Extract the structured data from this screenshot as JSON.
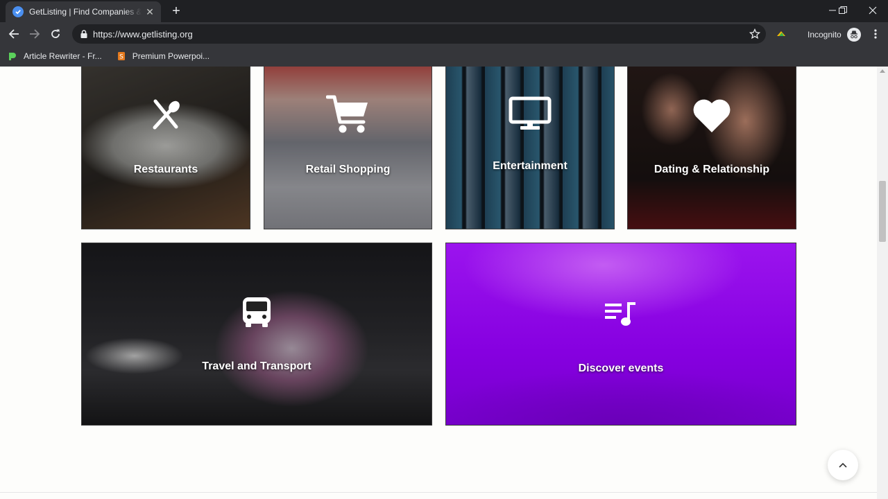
{
  "browser": {
    "tab_title": "GetListing | Find Companies & Tr",
    "url": "https://www.getlisting.org",
    "profile_label": "Incognito",
    "bookmarks": [
      {
        "label": "Article Rewriter - Fr...",
        "icon": "rewriter-favicon"
      },
      {
        "label": "Premium Powerpoi...",
        "icon": "slides-favicon"
      }
    ]
  },
  "categories": [
    {
      "label": "Restaurants",
      "icon": "fork-spoon-icon"
    },
    {
      "label": "Retail Shopping",
      "icon": "shopping-cart-icon"
    },
    {
      "label": "Entertainment",
      "icon": "monitor-icon"
    },
    {
      "label": "Dating & Relationship",
      "icon": "heart-icon"
    },
    {
      "label": "Travel and Transport",
      "icon": "bus-icon"
    },
    {
      "label": "Discover events",
      "icon": "playlist-music-icon"
    }
  ],
  "colors": {
    "events_purple": "#8b00e6",
    "chrome_dark": "#35363a"
  }
}
